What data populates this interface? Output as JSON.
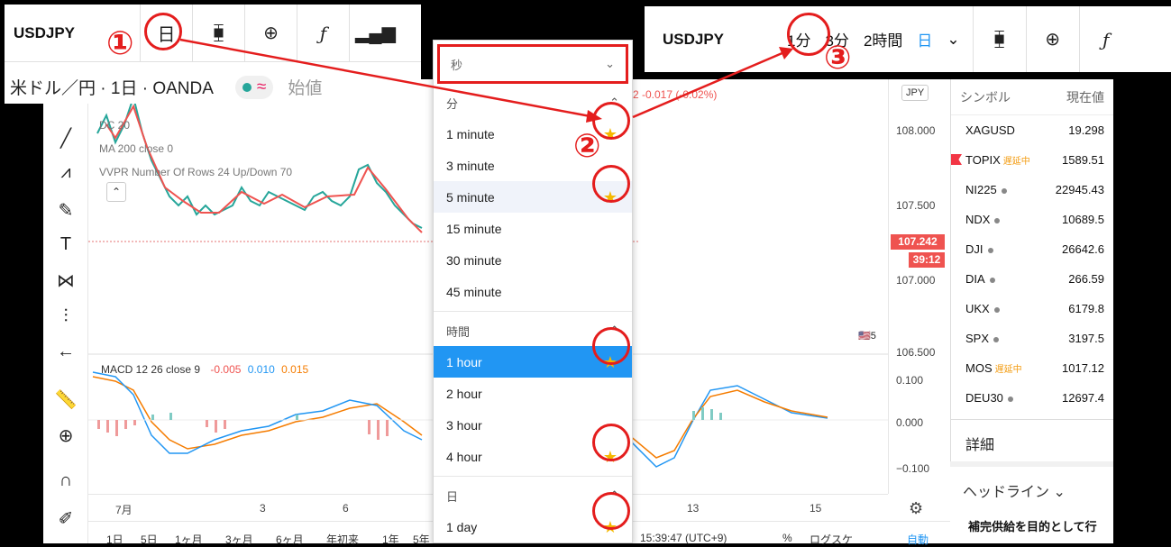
{
  "inset_left": {
    "symbol": "USDJPY",
    "interval_btn": "日",
    "subtitle": "米ドル／円 · 1日 · OANDA",
    "extra": "始値"
  },
  "inset_right": {
    "symbol": "USDJPY",
    "intervals": [
      "1分",
      "3分",
      "2時間",
      "日"
    ],
    "chevron": "⌄"
  },
  "dropdown": {
    "top_select": "秒",
    "sections": [
      {
        "header": "分",
        "items": [
          "1 minute",
          "3 minute",
          "5 minute",
          "15 minute",
          "30 minute",
          "45 minute"
        ]
      },
      {
        "header": "時間",
        "items": [
          "1 hour",
          "2 hour",
          "3 hour",
          "4 hour"
        ]
      },
      {
        "header": "日",
        "items": [
          "1 day"
        ]
      }
    ]
  },
  "chart": {
    "indicators": [
      "DC 20",
      "MA 200 close 0",
      "VVPR Number Of Rows 24 Up/Down 70"
    ],
    "macd_label": "MACD 12 26 close 9",
    "macd_values": [
      "-0.005",
      "0.010",
      "0.015"
    ],
    "change_text": "2 -0.017 (-0.02%)",
    "currency": "JPY",
    "price_ticks": [
      "108.000",
      "107.500",
      "107.000",
      "106.500"
    ],
    "last_price": "107.242",
    "countdown": "39:12",
    "macd_ticks": [
      "0.100",
      "0.000",
      "−0.100"
    ],
    "time_labels": [
      "7月",
      "3",
      "6",
      "13",
      "15"
    ],
    "bottom_items": [
      "1日",
      "5日",
      "1ヶ月",
      "3ヶ月",
      "6ヶ月",
      "年初来",
      "1年",
      "5年",
      "15:39:47 (UTC+9)",
      "%",
      "ログスケ",
      "自動"
    ],
    "badge_num": "5"
  },
  "watchlist": {
    "col_symbol": "シンボル",
    "col_price": "現在値",
    "rows": [
      {
        "symbol": "XAGUSD",
        "price": "19.298"
      },
      {
        "symbol": "TOPIX",
        "price": "1589.51",
        "delayed": "遅延中"
      },
      {
        "symbol": "NI225",
        "price": "22945.43"
      },
      {
        "symbol": "NDX",
        "price": "10689.5"
      },
      {
        "symbol": "DJI",
        "price": "26642.6"
      },
      {
        "symbol": "DIA",
        "price": "266.59"
      },
      {
        "symbol": "UKX",
        "price": "6179.8"
      },
      {
        "symbol": "SPX",
        "price": "3197.5"
      },
      {
        "symbol": "MOS",
        "price": "1017.12",
        "delayed": "遅延中"
      },
      {
        "symbol": "DEU30",
        "price": "12697.4"
      }
    ],
    "details": "詳細",
    "headlines": "ヘッドライン",
    "headline_text": "補完供給を目的として行"
  },
  "annotations": [
    "①",
    "②",
    "③"
  ]
}
